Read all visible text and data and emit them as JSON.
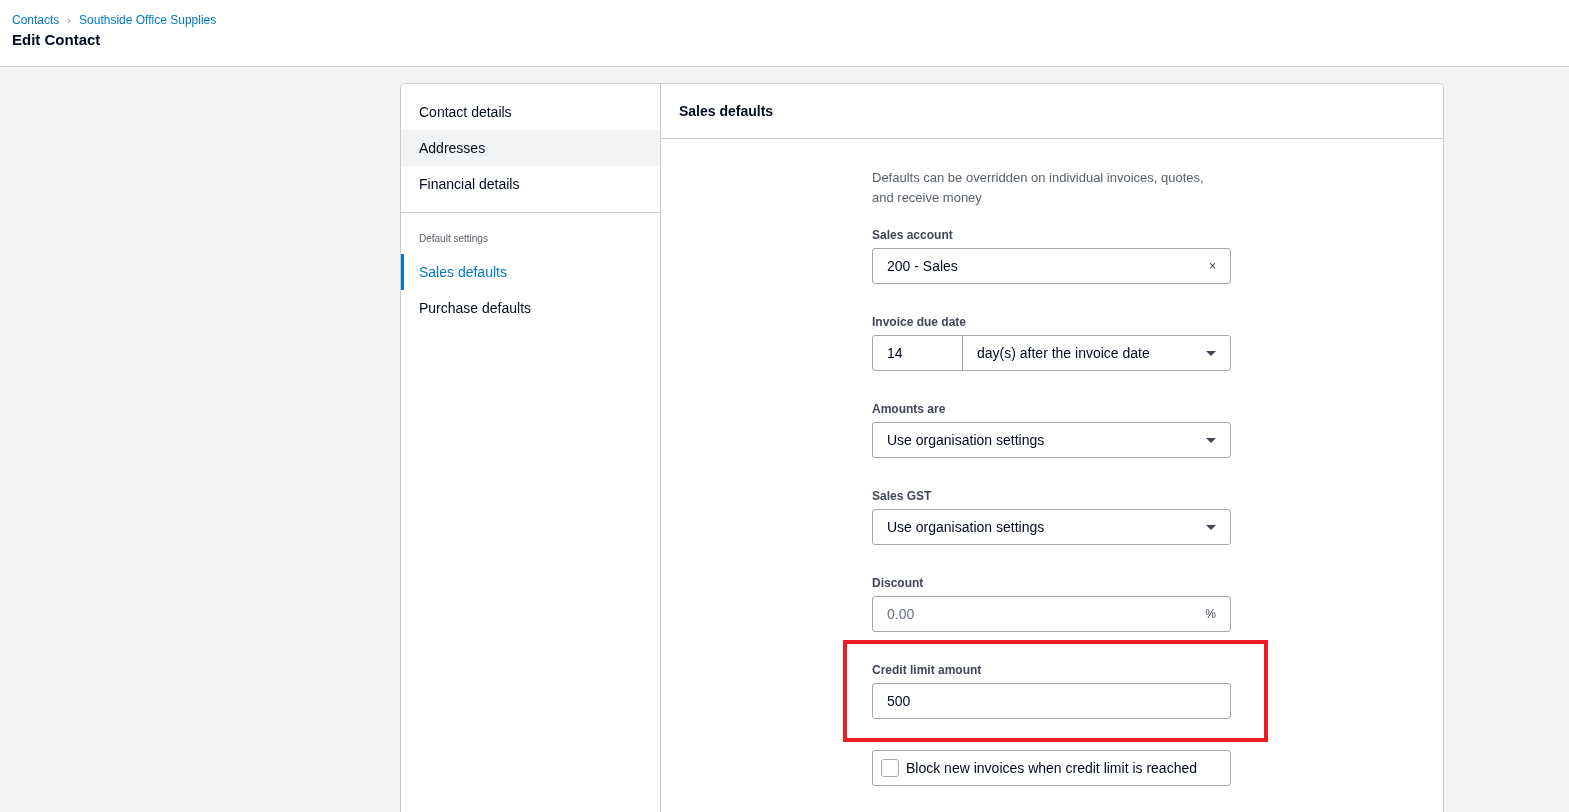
{
  "breadcrumb": [
    {
      "label": "Contacts"
    },
    {
      "label": "Southside Office Supplies"
    }
  ],
  "breadcrumb_separator": "›",
  "page_title": "Edit Contact",
  "sidebar": {
    "groups": [
      {
        "items": [
          {
            "label": "Contact details",
            "selected": false,
            "hovered": false
          },
          {
            "label": "Addresses",
            "selected": false,
            "hovered": true
          },
          {
            "label": "Financial details",
            "selected": false,
            "hovered": false
          }
        ]
      },
      {
        "heading": "Default settings",
        "items": [
          {
            "label": "Sales defaults",
            "selected": true,
            "hovered": false
          },
          {
            "label": "Purchase defaults",
            "selected": false,
            "hovered": false
          }
        ]
      }
    ]
  },
  "panel": {
    "title": "Sales defaults",
    "description": "Defaults can be overridden on individual invoices, quotes, and receive money",
    "fields": [
      {
        "kind": "clearable",
        "label": "Sales account",
        "value": "200 - Sales",
        "clear": "×",
        "highlighted": false
      },
      {
        "kind": "split",
        "label": "Invoice due date",
        "value": "14",
        "option": "day(s) after the invoice date",
        "highlighted": false
      },
      {
        "kind": "select",
        "label": "Amounts are",
        "value": "Use organisation settings",
        "highlighted": false
      },
      {
        "kind": "select",
        "label": "Sales GST",
        "value": "Use organisation settings",
        "highlighted": false
      },
      {
        "kind": "suffix",
        "label": "Discount",
        "placeholder": "0.00",
        "suffix": "%",
        "highlighted": false
      },
      {
        "kind": "text",
        "label": "Credit limit amount",
        "value": "500",
        "highlighted": true
      },
      {
        "kind": "checkbox",
        "label": "Block new invoices when credit limit is reached",
        "checked": false,
        "highlighted": false
      }
    ]
  }
}
